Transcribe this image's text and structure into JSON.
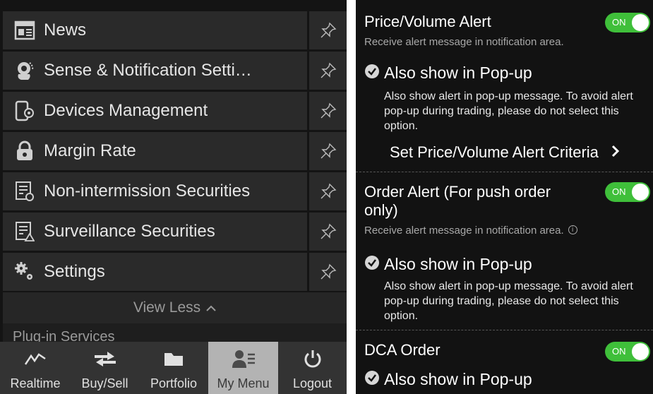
{
  "menu": {
    "items": [
      {
        "label": "News",
        "icon": "news-icon"
      },
      {
        "label": "Sense & Notification Setti…",
        "icon": "notification-settings-icon"
      },
      {
        "label": "Devices Management",
        "icon": "devices-icon"
      },
      {
        "label": "Margin Rate",
        "icon": "lock-icon"
      },
      {
        "label": "Non-intermission Securities",
        "icon": "list-clock-icon"
      },
      {
        "label": "Surveillance Securities",
        "icon": "list-warning-icon"
      },
      {
        "label": "Settings",
        "icon": "gears-icon"
      }
    ],
    "pin_icon": "pin-icon",
    "view_less": "View Less",
    "plugin_label": "Plug-in Services"
  },
  "tabbar": {
    "tabs": [
      {
        "label": "Realtime",
        "icon": "chart-line-icon"
      },
      {
        "label": "Buy/Sell",
        "icon": "exchange-arrows-icon"
      },
      {
        "label": "Portfolio",
        "icon": "folder-icon"
      },
      {
        "label": "My Menu",
        "icon": "user-list-icon",
        "active": true
      },
      {
        "label": "Logout",
        "icon": "power-icon"
      }
    ]
  },
  "alerts": {
    "price_volume": {
      "title": "Price/Volume Alert",
      "subtitle": "Receive alert message in notification area.",
      "toggle": "ON",
      "popup_label": "Also show in Pop-up",
      "popup_desc": "Also show alert in pop-up message. To avoid alert pop-up during trading, please do not select this option.",
      "criteria_label": "Set Price/Volume Alert Criteria"
    },
    "order": {
      "title": "Order Alert (For push order only)",
      "subtitle": "Receive alert message in notification area.",
      "toggle": "ON",
      "popup_label": "Also show in Pop-up",
      "popup_desc": "Also show alert in pop-up message. To avoid alert pop-up during trading, please do not select this option."
    },
    "dca": {
      "title": "DCA Order",
      "toggle": "ON",
      "popup_label": "Also show in Pop-up"
    }
  },
  "colors": {
    "toggle_on": "#3fbf3a",
    "panel_bg": "#121212",
    "menu_row_bg": "#2a2a2a",
    "active_tab_bg": "#b3b3b3"
  }
}
